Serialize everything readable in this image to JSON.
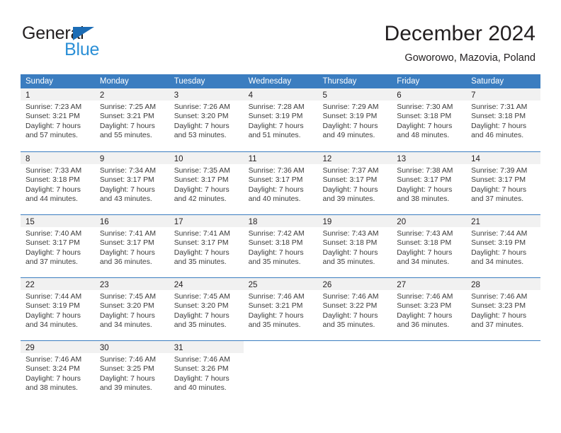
{
  "brand": {
    "name_part1": "General",
    "name_part2": "Blue",
    "accent_color": "#2b8fd6",
    "triangle_color": "#1b6cb5"
  },
  "header": {
    "title": "December 2024",
    "subtitle": "Goworowo, Mazovia, Poland"
  },
  "calendar": {
    "header_bg": "#3b7dc0",
    "day_band_bg": "#f1f1f1",
    "weekdays": [
      "Sunday",
      "Monday",
      "Tuesday",
      "Wednesday",
      "Thursday",
      "Friday",
      "Saturday"
    ],
    "weeks": [
      [
        {
          "day": "1",
          "sunrise": "Sunrise: 7:23 AM",
          "sunset": "Sunset: 3:21 PM",
          "daylight_line1": "Daylight: 7 hours",
          "daylight_line2": "and 57 minutes."
        },
        {
          "day": "2",
          "sunrise": "Sunrise: 7:25 AM",
          "sunset": "Sunset: 3:21 PM",
          "daylight_line1": "Daylight: 7 hours",
          "daylight_line2": "and 55 minutes."
        },
        {
          "day": "3",
          "sunrise": "Sunrise: 7:26 AM",
          "sunset": "Sunset: 3:20 PM",
          "daylight_line1": "Daylight: 7 hours",
          "daylight_line2": "and 53 minutes."
        },
        {
          "day": "4",
          "sunrise": "Sunrise: 7:28 AM",
          "sunset": "Sunset: 3:19 PM",
          "daylight_line1": "Daylight: 7 hours",
          "daylight_line2": "and 51 minutes."
        },
        {
          "day": "5",
          "sunrise": "Sunrise: 7:29 AM",
          "sunset": "Sunset: 3:19 PM",
          "daylight_line1": "Daylight: 7 hours",
          "daylight_line2": "and 49 minutes."
        },
        {
          "day": "6",
          "sunrise": "Sunrise: 7:30 AM",
          "sunset": "Sunset: 3:18 PM",
          "daylight_line1": "Daylight: 7 hours",
          "daylight_line2": "and 48 minutes."
        },
        {
          "day": "7",
          "sunrise": "Sunrise: 7:31 AM",
          "sunset": "Sunset: 3:18 PM",
          "daylight_line1": "Daylight: 7 hours",
          "daylight_line2": "and 46 minutes."
        }
      ],
      [
        {
          "day": "8",
          "sunrise": "Sunrise: 7:33 AM",
          "sunset": "Sunset: 3:18 PM",
          "daylight_line1": "Daylight: 7 hours",
          "daylight_line2": "and 44 minutes."
        },
        {
          "day": "9",
          "sunrise": "Sunrise: 7:34 AM",
          "sunset": "Sunset: 3:17 PM",
          "daylight_line1": "Daylight: 7 hours",
          "daylight_line2": "and 43 minutes."
        },
        {
          "day": "10",
          "sunrise": "Sunrise: 7:35 AM",
          "sunset": "Sunset: 3:17 PM",
          "daylight_line1": "Daylight: 7 hours",
          "daylight_line2": "and 42 minutes."
        },
        {
          "day": "11",
          "sunrise": "Sunrise: 7:36 AM",
          "sunset": "Sunset: 3:17 PM",
          "daylight_line1": "Daylight: 7 hours",
          "daylight_line2": "and 40 minutes."
        },
        {
          "day": "12",
          "sunrise": "Sunrise: 7:37 AM",
          "sunset": "Sunset: 3:17 PM",
          "daylight_line1": "Daylight: 7 hours",
          "daylight_line2": "and 39 minutes."
        },
        {
          "day": "13",
          "sunrise": "Sunrise: 7:38 AM",
          "sunset": "Sunset: 3:17 PM",
          "daylight_line1": "Daylight: 7 hours",
          "daylight_line2": "and 38 minutes."
        },
        {
          "day": "14",
          "sunrise": "Sunrise: 7:39 AM",
          "sunset": "Sunset: 3:17 PM",
          "daylight_line1": "Daylight: 7 hours",
          "daylight_line2": "and 37 minutes."
        }
      ],
      [
        {
          "day": "15",
          "sunrise": "Sunrise: 7:40 AM",
          "sunset": "Sunset: 3:17 PM",
          "daylight_line1": "Daylight: 7 hours",
          "daylight_line2": "and 37 minutes."
        },
        {
          "day": "16",
          "sunrise": "Sunrise: 7:41 AM",
          "sunset": "Sunset: 3:17 PM",
          "daylight_line1": "Daylight: 7 hours",
          "daylight_line2": "and 36 minutes."
        },
        {
          "day": "17",
          "sunrise": "Sunrise: 7:41 AM",
          "sunset": "Sunset: 3:17 PM",
          "daylight_line1": "Daylight: 7 hours",
          "daylight_line2": "and 35 minutes."
        },
        {
          "day": "18",
          "sunrise": "Sunrise: 7:42 AM",
          "sunset": "Sunset: 3:18 PM",
          "daylight_line1": "Daylight: 7 hours",
          "daylight_line2": "and 35 minutes."
        },
        {
          "day": "19",
          "sunrise": "Sunrise: 7:43 AM",
          "sunset": "Sunset: 3:18 PM",
          "daylight_line1": "Daylight: 7 hours",
          "daylight_line2": "and 35 minutes."
        },
        {
          "day": "20",
          "sunrise": "Sunrise: 7:43 AM",
          "sunset": "Sunset: 3:18 PM",
          "daylight_line1": "Daylight: 7 hours",
          "daylight_line2": "and 34 minutes."
        },
        {
          "day": "21",
          "sunrise": "Sunrise: 7:44 AM",
          "sunset": "Sunset: 3:19 PM",
          "daylight_line1": "Daylight: 7 hours",
          "daylight_line2": "and 34 minutes."
        }
      ],
      [
        {
          "day": "22",
          "sunrise": "Sunrise: 7:44 AM",
          "sunset": "Sunset: 3:19 PM",
          "daylight_line1": "Daylight: 7 hours",
          "daylight_line2": "and 34 minutes."
        },
        {
          "day": "23",
          "sunrise": "Sunrise: 7:45 AM",
          "sunset": "Sunset: 3:20 PM",
          "daylight_line1": "Daylight: 7 hours",
          "daylight_line2": "and 34 minutes."
        },
        {
          "day": "24",
          "sunrise": "Sunrise: 7:45 AM",
          "sunset": "Sunset: 3:20 PM",
          "daylight_line1": "Daylight: 7 hours",
          "daylight_line2": "and 35 minutes."
        },
        {
          "day": "25",
          "sunrise": "Sunrise: 7:46 AM",
          "sunset": "Sunset: 3:21 PM",
          "daylight_line1": "Daylight: 7 hours",
          "daylight_line2": "and 35 minutes."
        },
        {
          "day": "26",
          "sunrise": "Sunrise: 7:46 AM",
          "sunset": "Sunset: 3:22 PM",
          "daylight_line1": "Daylight: 7 hours",
          "daylight_line2": "and 35 minutes."
        },
        {
          "day": "27",
          "sunrise": "Sunrise: 7:46 AM",
          "sunset": "Sunset: 3:23 PM",
          "daylight_line1": "Daylight: 7 hours",
          "daylight_line2": "and 36 minutes."
        },
        {
          "day": "28",
          "sunrise": "Sunrise: 7:46 AM",
          "sunset": "Sunset: 3:23 PM",
          "daylight_line1": "Daylight: 7 hours",
          "daylight_line2": "and 37 minutes."
        }
      ],
      [
        {
          "day": "29",
          "sunrise": "Sunrise: 7:46 AM",
          "sunset": "Sunset: 3:24 PM",
          "daylight_line1": "Daylight: 7 hours",
          "daylight_line2": "and 38 minutes."
        },
        {
          "day": "30",
          "sunrise": "Sunrise: 7:46 AM",
          "sunset": "Sunset: 3:25 PM",
          "daylight_line1": "Daylight: 7 hours",
          "daylight_line2": "and 39 minutes."
        },
        {
          "day": "31",
          "sunrise": "Sunrise: 7:46 AM",
          "sunset": "Sunset: 3:26 PM",
          "daylight_line1": "Daylight: 7 hours",
          "daylight_line2": "and 40 minutes."
        },
        {
          "day": "",
          "sunrise": "",
          "sunset": "",
          "daylight_line1": "",
          "daylight_line2": ""
        },
        {
          "day": "",
          "sunrise": "",
          "sunset": "",
          "daylight_line1": "",
          "daylight_line2": ""
        },
        {
          "day": "",
          "sunrise": "",
          "sunset": "",
          "daylight_line1": "",
          "daylight_line2": ""
        },
        {
          "day": "",
          "sunrise": "",
          "sunset": "",
          "daylight_line1": "",
          "daylight_line2": ""
        }
      ]
    ]
  }
}
